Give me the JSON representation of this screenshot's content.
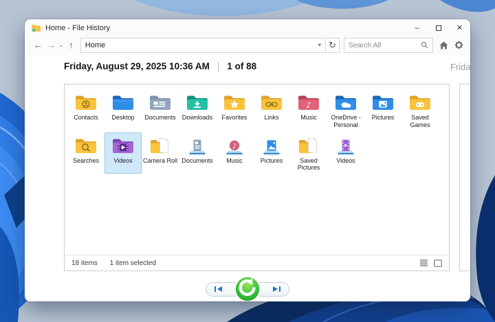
{
  "window": {
    "title": "Home - File History"
  },
  "window_controls": {
    "minimize": "–",
    "close": "✕"
  },
  "toolbar": {
    "back": "←",
    "forward": "→",
    "recent_chevron": "⌄",
    "up": "↑",
    "address_value": "Home",
    "address_chevron": "▾",
    "refresh": "↻",
    "search_placeholder": "Search All"
  },
  "header": {
    "date": "Friday, August 29, 2025 10:36 AM",
    "divider": "|",
    "position": "1 of 88"
  },
  "next_panel": {
    "date_partial": "Friday,"
  },
  "file_list": {
    "items": [
      {
        "label": "Contacts",
        "icon": "contacts-folder-icon",
        "selected": false
      },
      {
        "label": "Desktop",
        "icon": "desktop-folder-icon",
        "selected": false
      },
      {
        "label": "Documents",
        "icon": "documents-folder-icon",
        "selected": false
      },
      {
        "label": "Downloads",
        "icon": "downloads-folder-icon",
        "selected": false
      },
      {
        "label": "Favorites",
        "icon": "favorites-folder-icon",
        "selected": false
      },
      {
        "label": "Links",
        "icon": "links-folder-icon",
        "selected": false
      },
      {
        "label": "Music",
        "icon": "music-folder-icon",
        "selected": false
      },
      {
        "label": "OneDrive - Personal",
        "icon": "onedrive-folder-icon",
        "selected": false
      },
      {
        "label": "Pictures",
        "icon": "pictures-folder-icon",
        "selected": false
      },
      {
        "label": "Saved Games",
        "icon": "saved-games-folder-icon",
        "selected": false
      },
      {
        "label": "Searches",
        "icon": "searches-folder-icon",
        "selected": false
      },
      {
        "label": "Videos",
        "icon": "videos-folder-icon",
        "selected": true
      },
      {
        "label": "Camera Roll",
        "icon": "camera-roll-folder-icon",
        "selected": false
      },
      {
        "label": "Documents",
        "icon": "documents-library-icon",
        "selected": false
      },
      {
        "label": "Music",
        "icon": "music-library-icon",
        "selected": false
      },
      {
        "label": "Pictures",
        "icon": "pictures-library-icon",
        "selected": false
      },
      {
        "label": "Saved Pictures",
        "icon": "saved-pictures-folder-icon",
        "selected": false
      },
      {
        "label": "Videos",
        "icon": "videos-library-icon",
        "selected": false
      }
    ]
  },
  "statusbar": {
    "item_count": "18 items",
    "selection": "1 item selected"
  },
  "colors": {
    "selection_bg": "#cfe9fb",
    "selection_border": "#99c7e4",
    "restore_green": "#2db52d",
    "accent_blue": "#1e76c8",
    "desktop_base": "#b7c4d3",
    "bloom_blue": "#2f7ce4",
    "bloom_dark": "#0a2d63"
  }
}
